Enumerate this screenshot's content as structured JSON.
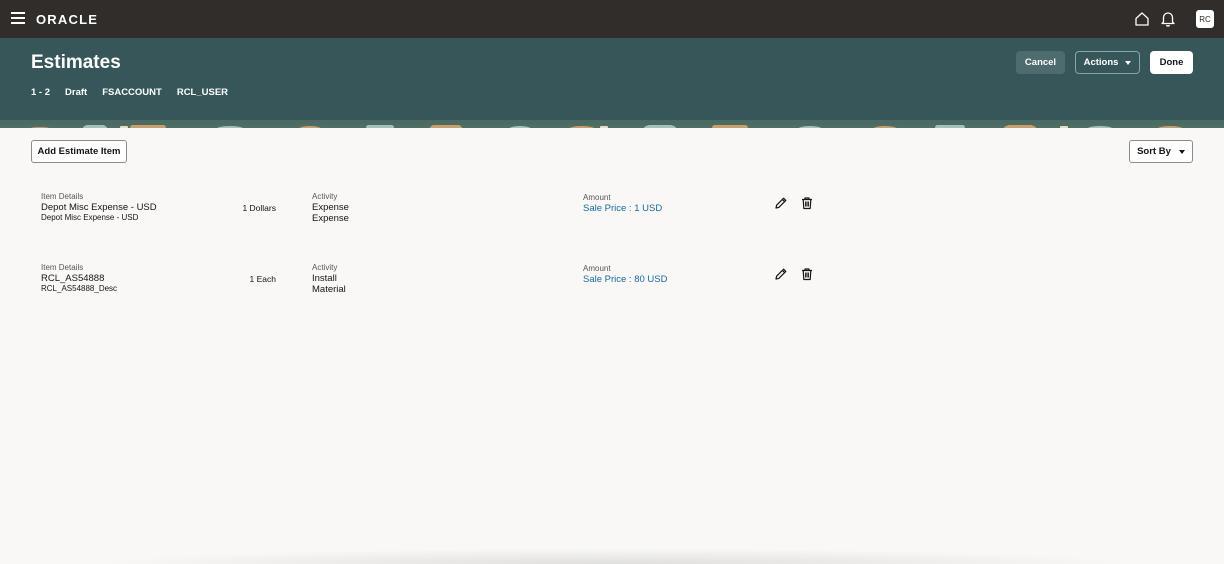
{
  "topbar": {
    "brand": "ORACLE",
    "avatar_initials": "RC"
  },
  "header": {
    "title": "Estimates",
    "meta": [
      "1 - 2",
      "Draft",
      "FSACCOUNT",
      "RCL_USER"
    ],
    "cancel_label": "Cancel",
    "actions_label": "Actions",
    "done_label": "Done"
  },
  "toolbar": {
    "add_label": "Add Estimate Item",
    "sort_label": "Sort By"
  },
  "items": [
    {
      "details_label": "Item Details",
      "name": "Depot Misc Expense - USD",
      "description": "Depot Misc Expense - USD",
      "quantity": "1 Dollars",
      "activity_label": "Activity",
      "activity_line1": "Expense",
      "activity_line2": "Expense",
      "amount_label": "Amount",
      "price": "Sale Price : 1 USD"
    },
    {
      "details_label": "Item Details",
      "name": "RCL_AS54888",
      "description": "RCL_AS54888_Desc",
      "quantity": "1 Each",
      "activity_label": "Activity",
      "activity_line1": "Install",
      "activity_line2": "Material",
      "amount_label": "Amount",
      "price": "Sale Price : 80 USD"
    }
  ],
  "colors": {
    "topbar": "#312d2a",
    "header": "#36565a",
    "link": "#1769a1",
    "page_bg": "#f9f8f6"
  },
  "icons": [
    "menu-icon",
    "home-icon",
    "bell-icon",
    "caret-down-icon",
    "pencil-icon",
    "trash-icon"
  ]
}
